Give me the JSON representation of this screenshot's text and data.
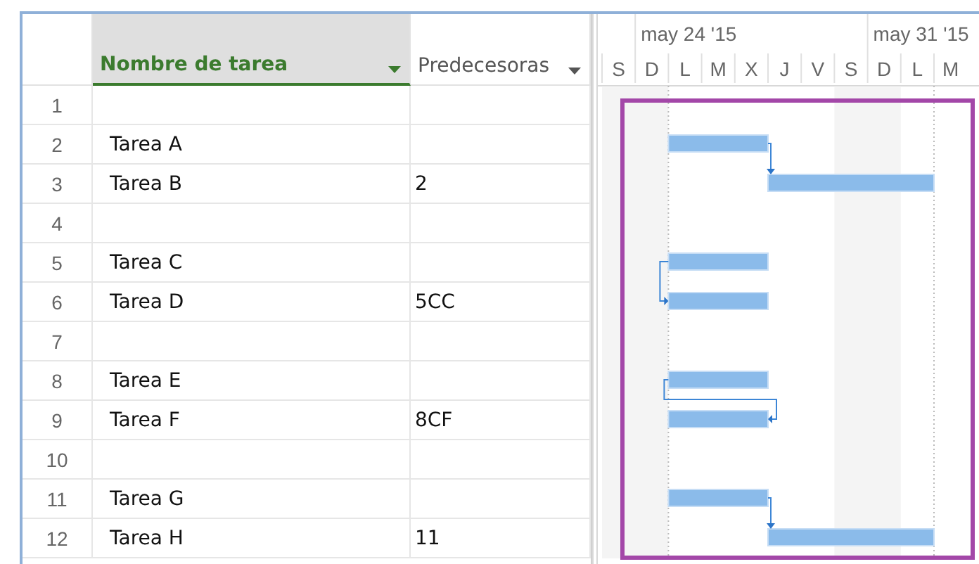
{
  "columns": [
    {
      "label": "Nombre de tarea",
      "selected": true
    },
    {
      "label": "Predecesoras",
      "selected": false
    }
  ],
  "rows": [
    {
      "number": "1"
    },
    {
      "number": "2",
      "name": "Tarea A"
    },
    {
      "number": "3",
      "name": "Tarea B",
      "predecessors": "2"
    },
    {
      "number": "4"
    },
    {
      "number": "5",
      "name": "Tarea C"
    },
    {
      "number": "6",
      "name": "Tarea D",
      "predecessors": "5CC"
    },
    {
      "number": "7"
    },
    {
      "number": "8",
      "name": "Tarea E"
    },
    {
      "number": "9",
      "name": "Tarea F",
      "predecessors": "8CF"
    },
    {
      "number": "10"
    },
    {
      "number": "11",
      "name": "Tarea G"
    },
    {
      "number": "12",
      "name": "Tarea H",
      "predecessors": "11"
    }
  ],
  "timescale": {
    "weeks": [
      "may 24 '15",
      "may 31 '15"
    ],
    "days": [
      "S",
      "D",
      "L",
      "M",
      "X",
      "J",
      "V",
      "S",
      "D",
      "L",
      "M"
    ]
  }
}
